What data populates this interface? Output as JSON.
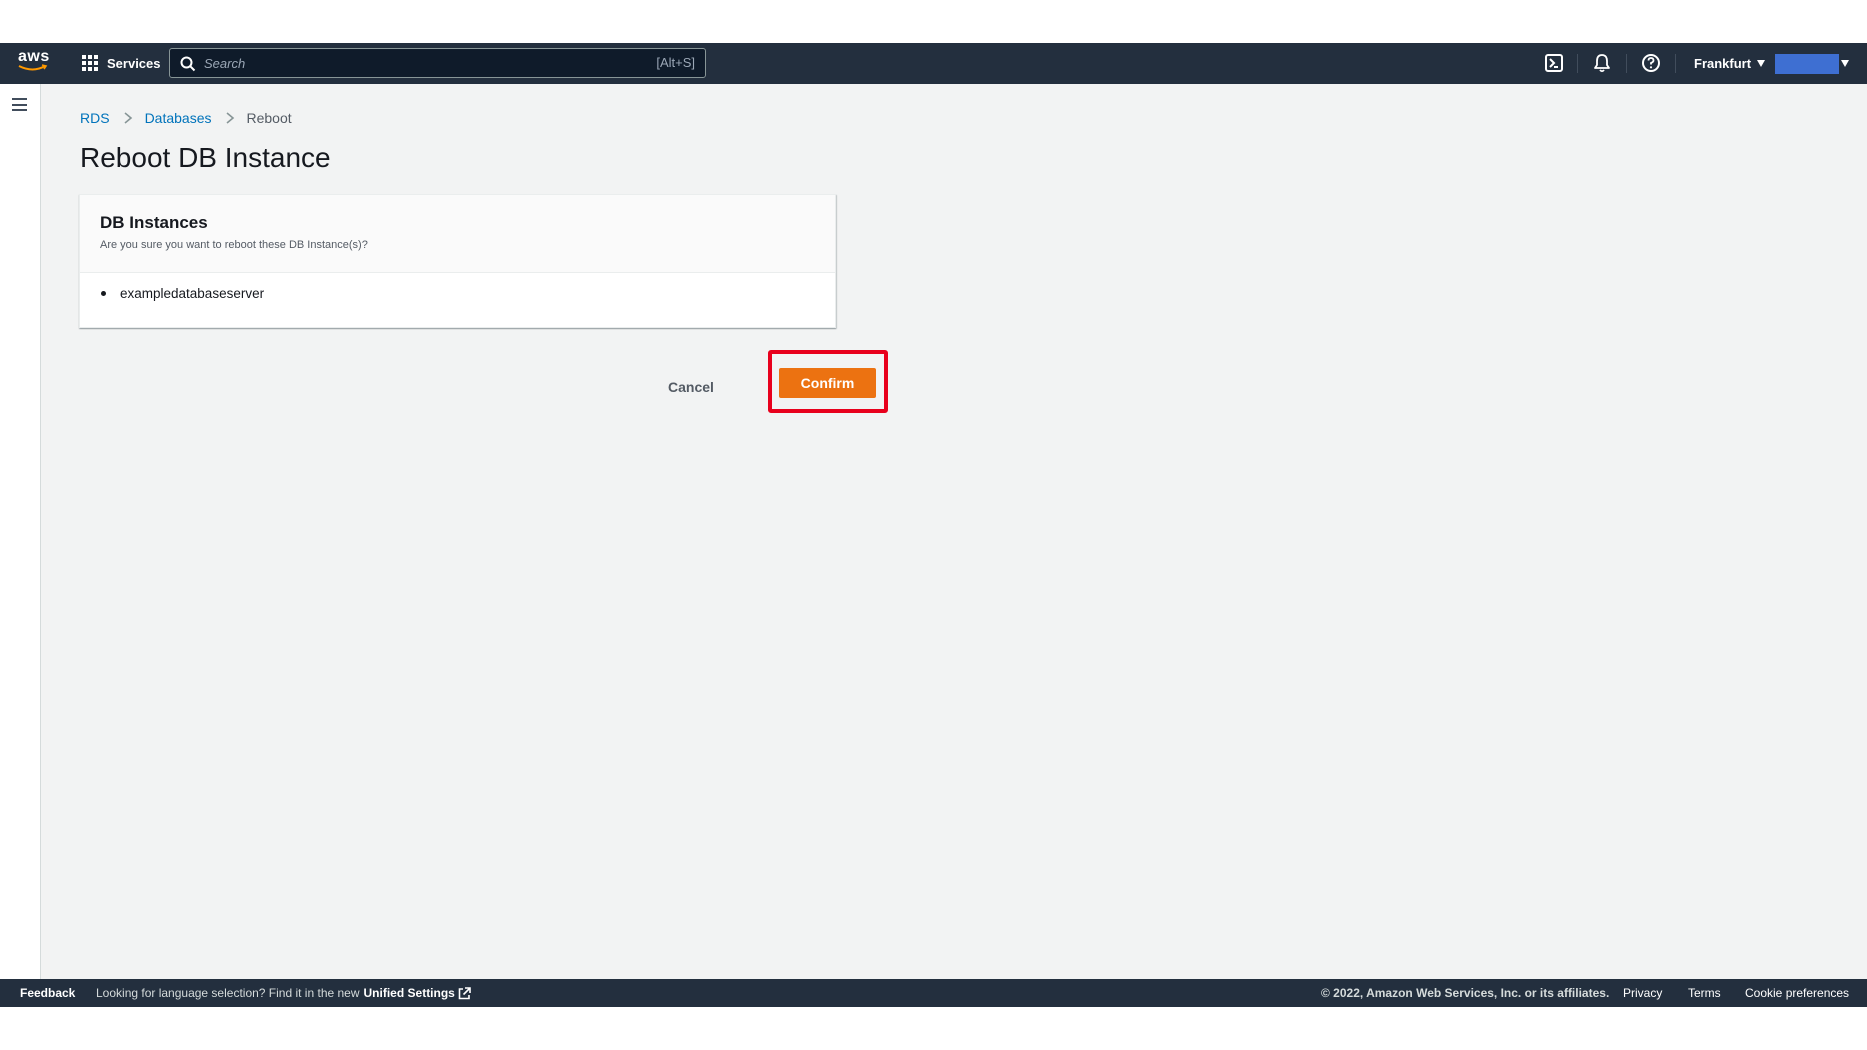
{
  "topnav": {
    "logo_text": "aws",
    "services_label": "Services",
    "search_placeholder": "Search",
    "search_shortcut": "[Alt+S]",
    "region_label": "Frankfurt",
    "account_color": "#3e6fd2"
  },
  "breadcrumb": {
    "items": [
      {
        "label": "RDS",
        "link": true
      },
      {
        "label": "Databases",
        "link": true
      },
      {
        "label": "Reboot",
        "link": false
      }
    ]
  },
  "page": {
    "title": "Reboot DB Instance"
  },
  "panel": {
    "title": "DB Instances",
    "description": "Are you sure you want to reboot these DB Instance(s)?",
    "instances": [
      "exampledatabaseserver"
    ]
  },
  "actions": {
    "cancel_label": "Cancel",
    "confirm_label": "Confirm"
  },
  "footer": {
    "feedback_label": "Feedback",
    "notice_text": "Looking for language selection? Find it in the new",
    "unified_settings_label": "Unified Settings",
    "copyright": "© 2022, Amazon Web Services, Inc. or its affiliates.",
    "privacy_label": "Privacy",
    "terms_label": "Terms",
    "cookie_label": "Cookie preferences"
  },
  "colors": {
    "nav_bg": "#232f3e",
    "page_bg": "#f2f3f3",
    "link": "#0073bb",
    "primary_button": "#ec7211",
    "highlight": "#e8001c"
  }
}
